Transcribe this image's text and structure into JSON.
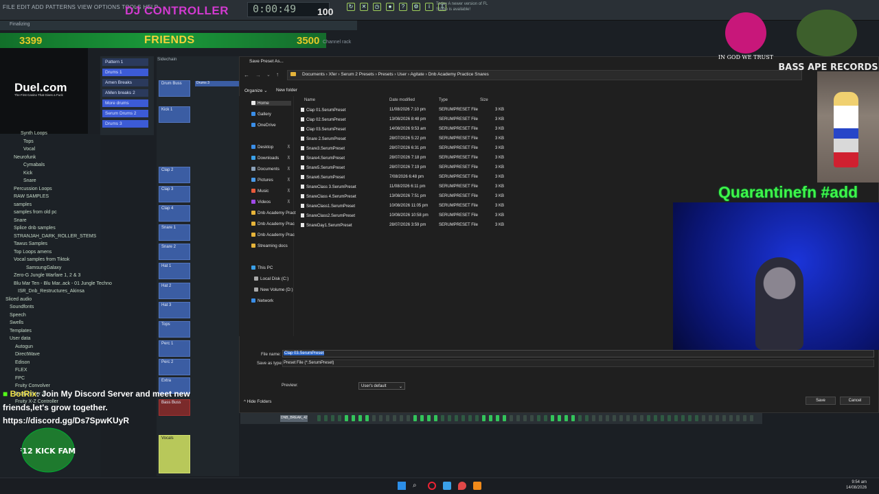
{
  "topbar": {
    "menu": "FILE EDIT ADD PATTERNS VIEW OPTIONS TOOLS HELP",
    "title": "DJ CONTROLLER",
    "time": "0:00:49",
    "tempo": "100",
    "tip": "Today  A newer version of FL Studio is available!",
    "status": "Finalizing"
  },
  "friends_bar": {
    "left_count": "3399",
    "label": "FRIENDS",
    "right_count": "3500",
    "channel_rack": "Channel rack"
  },
  "ad": {
    "logo": "Duel.com",
    "tagline": "The First Casino That Gives a Fuck"
  },
  "browser": {
    "items": [
      "Synth Loops",
      "Tops",
      "Vocal",
      "Neurofunk",
      "Cymabals",
      "Kick",
      "Snare",
      "Percussion Loops",
      "RAW SAMPLES",
      "samples",
      "samples from old pc",
      "Snare",
      "Splice dnb samples",
      "STRANJAH_DARK_ROLLER_STEMS",
      "Tawus Samples",
      "Top Loops amens",
      "Vocal samples from Tiktok",
      "SamsungGalaxy",
      "Zero-G Jungle Warfare 1, 2 & 3",
      "Blu Mar Ten - Blu Mar..ack - 01 Jungle Techno",
      "ISR_Dnb_Restructures_Akinsa",
      "Sliced audio",
      "Soundfonts",
      "Speech",
      "Swells",
      "Templates",
      "User data",
      "Autogun",
      "DirectWave",
      "Edison",
      "FLEX",
      "FPC",
      "Fruity Convolver",
      "Fruity Slicer 2",
      "Fruity X-Z Controller"
    ]
  },
  "patterns": [
    "Pattern 1",
    "Drums 1",
    "Amen Breaks",
    "AMen breaks 2",
    "More drums",
    "Serum Drums 2",
    "Drums 3"
  ],
  "playlist": {
    "header": "Sidechain",
    "tracks": [
      "Drum Buss",
      "Kick 1",
      "Clap 2",
      "Clap 3",
      "Clap 4",
      "Snare 1",
      "Snare 2",
      "Hat 1",
      "Hat 2",
      "Hat 3",
      "Tops",
      "Perc 1",
      "Perc 2",
      "Extra",
      "Bass Buss",
      "Vocals"
    ],
    "clip_label": "Drums 3"
  },
  "dialog": {
    "title": "Save Preset As...",
    "breadcrumbs": [
      "Documents",
      "Xfer",
      "Serum 2 Presets",
      "Presets",
      "User",
      "Agitate",
      "Dnb Academy Practice Snares"
    ],
    "organize": "Organize",
    "new_folder": "New folder",
    "nav": {
      "quick": [
        "Home",
        "Gallery",
        "OneDrive"
      ],
      "pinned": [
        "Desktop",
        "Downloads",
        "Documents",
        "Pictures",
        "Music",
        "Videos",
        "Dnb Academy Pract",
        "Dnb Academy Prac",
        "Dnb Academy Prac",
        "Streaming docs"
      ],
      "pc": [
        "This PC",
        "Local Disk (C:)",
        "New Volume (D:)",
        "Network"
      ]
    },
    "columns": {
      "name": "Name",
      "date": "Date modified",
      "type": "Type",
      "size": "Size"
    },
    "files": [
      {
        "name": "Clap 01.SerumPreset",
        "date": "11/08/2026 7:10 pm",
        "type": "SERUMPRESET File",
        "size": "3 KB"
      },
      {
        "name": "Clap 02.SerumPreset",
        "date": "13/08/2026 8:48 pm",
        "type": "SERUMPRESET File",
        "size": "3 KB"
      },
      {
        "name": "Clap 03.SerumPreset",
        "date": "14/08/2026 9:53 am",
        "type": "SERUMPRESET File",
        "size": "3 KB"
      },
      {
        "name": "Snare 2.SerumPreset",
        "date": "28/07/2026 5:22 pm",
        "type": "SERUMPRESET File",
        "size": "3 KB"
      },
      {
        "name": "Snare3.SerumPreset",
        "date": "28/07/2026 6:31 pm",
        "type": "SERUMPRESET File",
        "size": "3 KB"
      },
      {
        "name": "Snare4.SerumPreset",
        "date": "28/07/2026 7:18 pm",
        "type": "SERUMPRESET File",
        "size": "3 KB"
      },
      {
        "name": "Snare5.SerumPreset",
        "date": "28/07/2026 7:19 pm",
        "type": "SERUMPRESET File",
        "size": "3 KB"
      },
      {
        "name": "Snare6.SerumPreset",
        "date": "7/08/2026 6:48 pm",
        "type": "SERUMPRESET File",
        "size": "3 KB"
      },
      {
        "name": "SnareClass 3.SerumPreset",
        "date": "11/08/2026 6:11 pm",
        "type": "SERUMPRESET File",
        "size": "3 KB"
      },
      {
        "name": "SnareClass 4.SerumPreset",
        "date": "13/08/2026 7:51 pm",
        "type": "SERUMPRESET File",
        "size": "3 KB"
      },
      {
        "name": "SnareClass1.SerumPreset",
        "date": "10/08/2026 11:05 pm",
        "type": "SERUMPRESET File",
        "size": "3 KB"
      },
      {
        "name": "SnareClass2.SerumPreset",
        "date": "10/08/2026 10:58 pm",
        "type": "SERUMPRESET File",
        "size": "3 KB"
      },
      {
        "name": "SnareDay1.SerumPreset",
        "date": "28/07/2026 3:59 pm",
        "type": "SERUMPRESET File",
        "size": "3 KB"
      }
    ],
    "file_name_label": "File name:",
    "file_name_value": "Clap 03.SerumPreset",
    "save_type_label": "Save as type:",
    "save_type_value": "Preset File (*.SerumPreset)",
    "preview_label": "Preview:",
    "preview_value": "User's default",
    "hide_folders": "Hide Folders",
    "save": "Save",
    "cancel": "Cancel"
  },
  "sequencer": {
    "channel": "DNB_BREAK_42"
  },
  "stream": {
    "banner": "Quarantinefn #add",
    "logo_text": "IN GOD WE TRUST",
    "label_logo": "BASS APE RECORDS",
    "chat_bot": "BotRix",
    "chat_line1": ": Join My Discord Server and meet new",
    "chat_line2": "friends,let's grow together.",
    "chat_line3": "https://discord.gg/Ds7SpwKUyR",
    "kick_badge": "F12 KICK FAM!"
  },
  "taskbar": {
    "time": "9:54 am",
    "date": "14/08/2026"
  },
  "colors": {
    "accent": "#2a65c7",
    "friends_green": "#1a9a3a",
    "banner_green": "#3ef54a",
    "dj_pink": "#d23ad0",
    "step_green": "#33c45a"
  }
}
